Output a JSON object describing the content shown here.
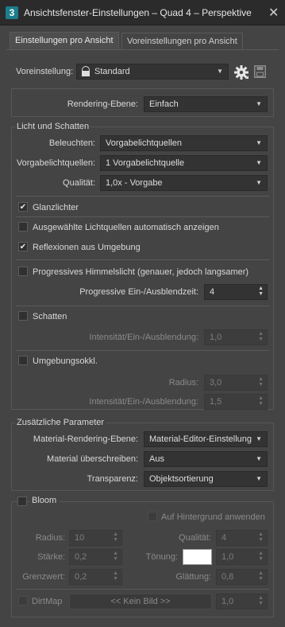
{
  "window": {
    "app_icon_text": "3",
    "title": "Ansichtsfenster-Einstellungen – Quad 4 – Perspektive",
    "close": "✕"
  },
  "tabs": [
    {
      "label": "Einstellungen pro Ansicht",
      "active": true
    },
    {
      "label": "Voreinstellungen pro Ansicht",
      "active": false
    }
  ],
  "preset": {
    "label": "Voreinstellung:",
    "value": "Standard",
    "lock_icon": "lock-icon",
    "gear_icon": "gear-icon",
    "save_icon": "save-icon"
  },
  "rendering_level": {
    "label": "Rendering-Ebene:",
    "value": "Einfach"
  },
  "light": {
    "title": "Licht und Schatten",
    "illuminate": {
      "label": "Beleuchten:",
      "value": "Vorgabelichtquellen"
    },
    "default_lights": {
      "label": "Vorgabelichtquellen:",
      "value": "1 Vorgabelichtquelle"
    },
    "quality": {
      "label": "Qualität:",
      "value": "1,0x - Vorgabe"
    },
    "highlights": {
      "label": "Glanzlichter",
      "checked": true
    },
    "auto_show": {
      "label": "Ausgewählte Lichtquellen automatisch anzeigen",
      "checked": false
    },
    "reflections": {
      "label": "Reflexionen aus Umgebung",
      "checked": true
    },
    "skylight": {
      "label": "Progressives Himmelslicht (genauer, jedoch langsamer)",
      "checked": false
    },
    "fade_time": {
      "label": "Progressive Ein-/Ausblendzeit:",
      "value": "4"
    },
    "shadows": {
      "label": "Schatten",
      "checked": false
    },
    "shadow_intensity": {
      "label": "Intensität/Ein-/Ausblendung:",
      "value": "1,0"
    },
    "ao": {
      "label": "Umgebungsokkl.",
      "checked": false
    },
    "ao_radius": {
      "label": "Radius:",
      "value": "3,0"
    },
    "ao_intensity": {
      "label": "Intensität/Ein-/Ausblendung:",
      "value": "1,5"
    }
  },
  "extra": {
    "title": "Zusätzliche Parameter",
    "material_level": {
      "label": "Material-Rendering-Ebene:",
      "value": "Material-Editor-Einstellung"
    },
    "override": {
      "label": "Material überschreiben:",
      "value": "Aus"
    },
    "transparency": {
      "label": "Transparenz:",
      "value": "Objektsortierung"
    }
  },
  "bloom": {
    "label": "Bloom",
    "checked": false,
    "apply_bg": {
      "label": "Auf Hintergrund anwenden",
      "checked": false
    },
    "radius": {
      "label": "Radius:",
      "value": "10"
    },
    "quality": {
      "label": "Qualität:",
      "value": "4"
    },
    "strength": {
      "label": "Stärke:",
      "value": "0,2"
    },
    "tint": {
      "label": "Tönung:",
      "value": "1,0",
      "color": "#ffffff"
    },
    "threshold": {
      "label": "Grenzwert:",
      "value": "0,2"
    },
    "smoothing": {
      "label": "Glättung:",
      "value": "0,8"
    },
    "dirtmap": {
      "label": "DirtMap",
      "checked": false,
      "button": "<< Kein Bild >>",
      "value": "1,0"
    }
  },
  "glyphs": {
    "check": "✔",
    "dropdown": "▼",
    "spin_up": "▲",
    "spin_down": "▼"
  }
}
